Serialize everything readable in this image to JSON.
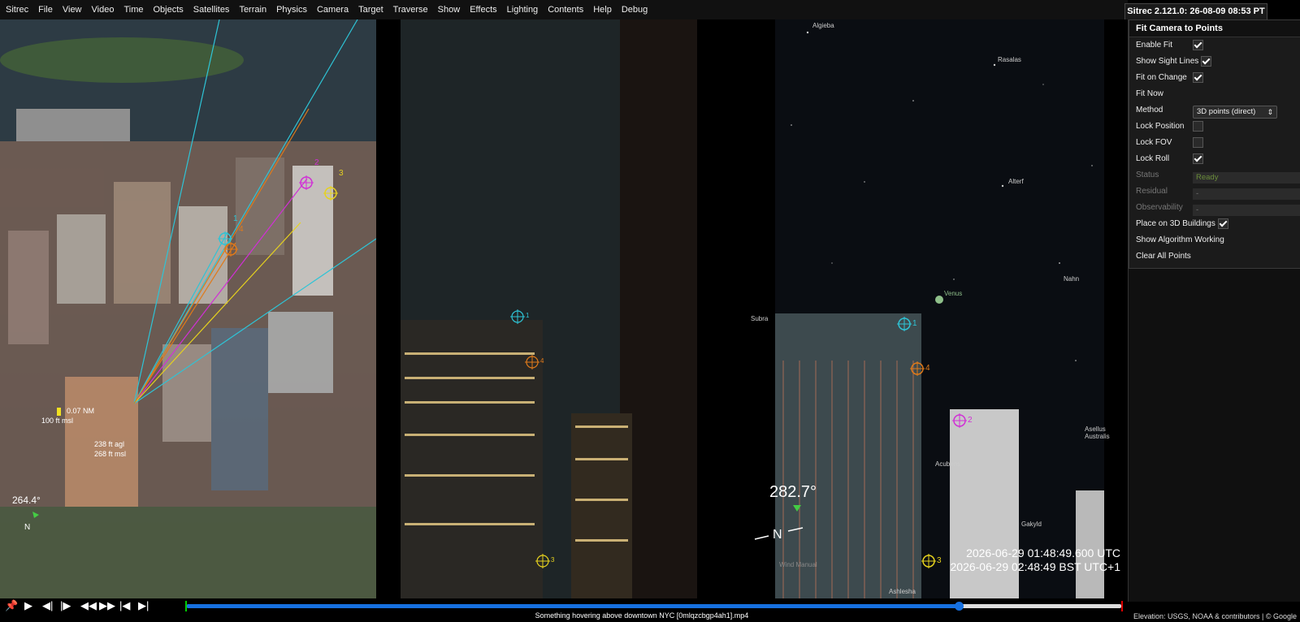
{
  "menu": [
    "Sitrec",
    "File",
    "View",
    "Video",
    "Time",
    "Objects",
    "Satellites",
    "Terrain",
    "Physics",
    "Camera",
    "Target",
    "Traverse",
    "Show",
    "Effects",
    "Lighting",
    "Contents",
    "Help",
    "Debug"
  ],
  "version": "Sitrec 2.121.0: 26-08-09 08:53 PT",
  "panel": {
    "title": "Fit Camera to Points",
    "rows": {
      "enable_fit": "Enable Fit",
      "show_sight_lines": "Show Sight Lines",
      "fit_on_change": "Fit on Change",
      "fit_now": "Fit Now",
      "method": "Method",
      "method_value": "3D points (direct)",
      "lock_position": "Lock Position",
      "lock_fov": "Lock FOV",
      "lock_roll": "Lock Roll",
      "status": "Status",
      "status_value": "Ready",
      "residual": "Residual",
      "residual_value": "-",
      "observability": "Observability",
      "observability_value": "-",
      "place_on_buildings": "Place on 3D Buildings",
      "show_algorithm": "Show Algorithm Working",
      "clear_points": "Clear All Points"
    },
    "checks": {
      "enable_fit": true,
      "show_sight_lines": true,
      "fit_on_change": true,
      "lock_position": false,
      "lock_fov": false,
      "lock_roll": true,
      "place_on_buildings": true
    }
  },
  "view3d": {
    "range": "0.07 NM",
    "target_msl": "100 ft msl",
    "cam_agl": "238 ft agl",
    "cam_msl": "268 ft msl",
    "heading": "264.4°",
    "north": "N",
    "markers": [
      "1",
      "4",
      "2",
      "3"
    ]
  },
  "video": {
    "markers": [
      "1",
      "4",
      "3"
    ]
  },
  "sky": {
    "heading": "282.7°",
    "north": "N",
    "utc": "2026-06-29 01:48:49.600 UTC",
    "local": "2026-06-29 02:48:49 BST UTC+1",
    "stars": [
      "Algieba",
      "Rasalas",
      "Alterf",
      "Nahn",
      "Venus",
      "Subra",
      "Acubens",
      "Asellus Australis",
      "Gakyld",
      "Wind Manual",
      "Ashlesha"
    ],
    "markers": [
      "1",
      "4",
      "2",
      "3"
    ]
  },
  "timeline": {
    "progress_fraction": 0.826,
    "video_title": "Something hovering above downtown NYC [0mlqzcbgp4ah1].mp4",
    "credits": "Elevation: USGS, NOAA & contributors | © Google"
  },
  "colors": {
    "marker1": "#2ec4d6",
    "marker2": "#d12fd6",
    "marker3": "#e6d21e",
    "marker4": "#e07a1a",
    "timeline_accent": "#1670e0"
  }
}
